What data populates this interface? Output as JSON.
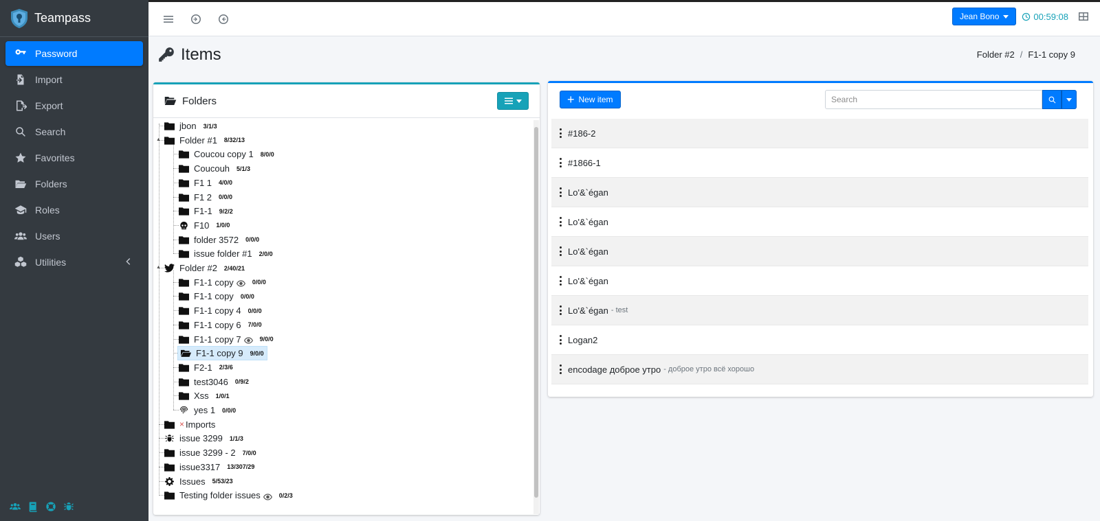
{
  "brand": {
    "name": "Teampass"
  },
  "sidebar": {
    "items": [
      {
        "label": "Password",
        "icon": "key-icon",
        "active": true
      },
      {
        "label": "Import",
        "icon": "import-icon"
      },
      {
        "label": "Export",
        "icon": "export-icon"
      },
      {
        "label": "Search",
        "icon": "search-icon"
      },
      {
        "label": "Favorites",
        "icon": "star-icon"
      },
      {
        "label": "Folders",
        "icon": "folder-icon"
      },
      {
        "label": "Roles",
        "icon": "graduation-cap-icon"
      },
      {
        "label": "Users",
        "icon": "users-icon"
      },
      {
        "label": "Utilities",
        "icon": "cubes-icon"
      }
    ]
  },
  "topbar": {
    "user": "Jean Bono",
    "timer": "00:59:08"
  },
  "page": {
    "title": "Items"
  },
  "breadcrumb": {
    "folder": "Folder #2",
    "sep": "/",
    "current": "F1-1 copy 9"
  },
  "folders": {
    "title": "Folders",
    "tree": [
      {
        "label": "jbon",
        "count": "3/1/3",
        "level": 0,
        "icon": "folder"
      },
      {
        "label": "Folder #1",
        "count": "8/32/13",
        "level": 0,
        "icon": "folder",
        "open": true
      },
      {
        "label": "Coucou copy 1",
        "count": "8/0/0",
        "level": 1,
        "icon": "folder"
      },
      {
        "label": "Coucouh",
        "count": "5/1/3",
        "level": 1,
        "icon": "folder"
      },
      {
        "label": "F1 1",
        "count": "4/0/0",
        "level": 1,
        "icon": "folder"
      },
      {
        "label": "F1 2",
        "count": "0/0/0",
        "level": 1,
        "icon": "folder"
      },
      {
        "label": "F1-1",
        "count": "9/2/2",
        "level": 1,
        "icon": "folder"
      },
      {
        "label": "F10",
        "count": "1/0/0",
        "level": 1,
        "icon": "skull"
      },
      {
        "label": "folder 3572",
        "count": "0/0/0",
        "level": 1,
        "icon": "folder"
      },
      {
        "label": "issue folder #1",
        "count": "2/0/0",
        "level": 1,
        "icon": "folder"
      },
      {
        "label": "Folder #2",
        "count": "2/40/21",
        "level": 0,
        "icon": "twitter",
        "open": true
      },
      {
        "label": "F1-1 copy",
        "count": "0/0/0",
        "level": 1,
        "icon": "folder",
        "eye": true
      },
      {
        "label": "F1-1 copy",
        "count": "0/0/0",
        "level": 1,
        "icon": "folder"
      },
      {
        "label": "F1-1 copy 4",
        "count": "0/0/0",
        "level": 1,
        "icon": "folder"
      },
      {
        "label": "F1-1 copy 6",
        "count": "7/0/0",
        "level": 1,
        "icon": "folder"
      },
      {
        "label": "F1-1 copy 7",
        "count": "9/0/0",
        "level": 1,
        "icon": "folder",
        "eye": true
      },
      {
        "label": "F1-1 copy 9",
        "count": "9/0/0",
        "level": 1,
        "icon": "folder-open",
        "selected": true
      },
      {
        "label": "F2-1",
        "count": "2/3/6",
        "level": 1,
        "icon": "folder"
      },
      {
        "label": "test3046",
        "count": "0/9/2",
        "level": 1,
        "icon": "folder"
      },
      {
        "label": "Xss",
        "count": "1/0/1",
        "level": 1,
        "icon": "folder"
      },
      {
        "label": "yes 1",
        "count": "0/0/0",
        "level": 1,
        "icon": "fingerprint"
      },
      {
        "label": "Imports",
        "count": "",
        "level": 0,
        "icon": "folder",
        "xmark": "×"
      },
      {
        "label": "issue 3299",
        "count": "1/1/3",
        "level": 0,
        "icon": "bug"
      },
      {
        "label": "issue 3299 - 2",
        "count": "7/0/0",
        "level": 0,
        "icon": "folder"
      },
      {
        "label": "issue3317",
        "count": "13/307/29",
        "level": 0,
        "icon": "folder"
      },
      {
        "label": "Issues",
        "count": "5/53/23",
        "level": 0,
        "icon": "gear"
      },
      {
        "label": "Testing folder issues",
        "count": "0/2/3",
        "level": 0,
        "icon": "folder",
        "eye": true
      }
    ]
  },
  "items": {
    "new_label": "New item",
    "search_placeholder": "Search",
    "list": [
      {
        "label": "#186-2",
        "desc": ""
      },
      {
        "label": "#1866-1",
        "desc": ""
      },
      {
        "label": "Lo'&`égan",
        "desc": ""
      },
      {
        "label": "Lo'&`égan",
        "desc": ""
      },
      {
        "label": "Lo'&`égan",
        "desc": ""
      },
      {
        "label": "Lo'&`égan",
        "desc": ""
      },
      {
        "label": "Lo'&`égan",
        "desc": "- test"
      },
      {
        "label": "Logan2",
        "desc": ""
      },
      {
        "label": "encodage доброе утро",
        "desc": "- доброе утро всё хорошо"
      }
    ]
  },
  "colors": {
    "primary": "#007bff",
    "info": "#17a2b8",
    "sidebar": "#343a40"
  }
}
